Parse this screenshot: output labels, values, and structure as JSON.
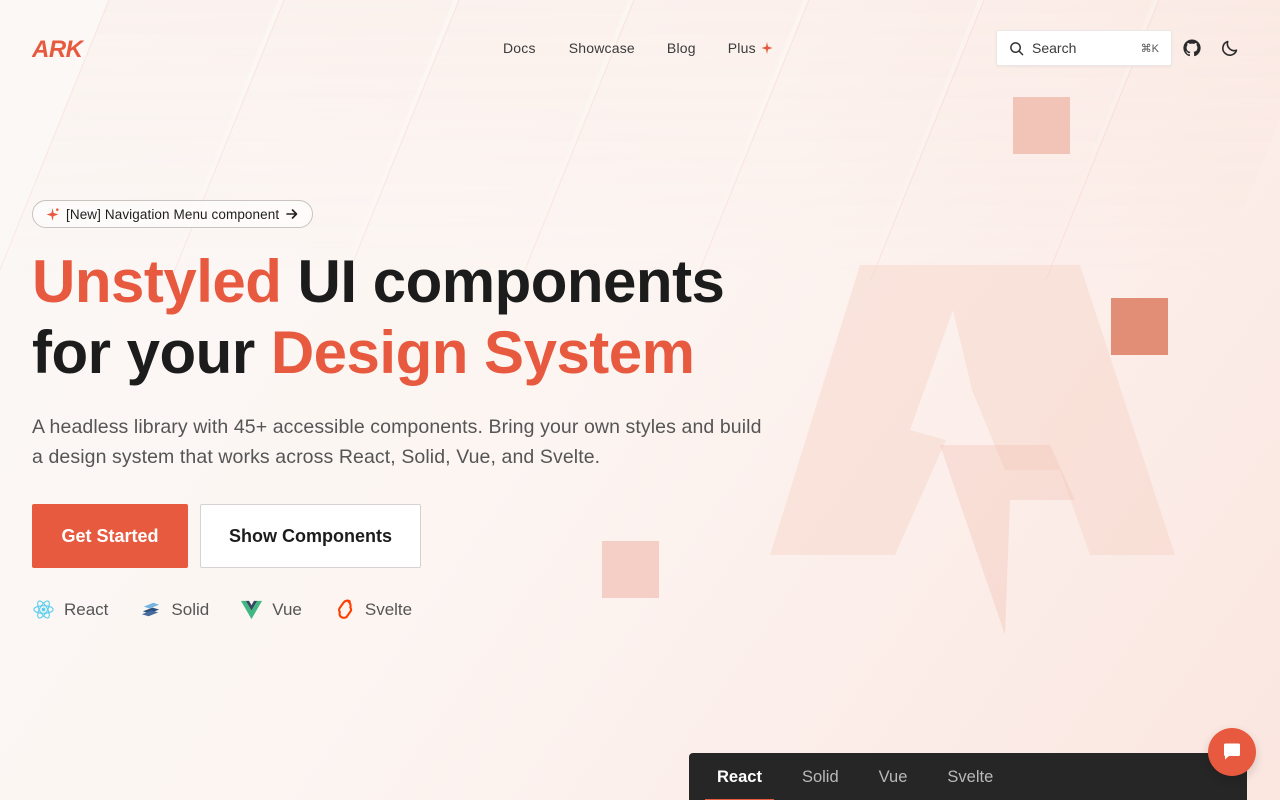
{
  "brand": {
    "name": "ARK",
    "accent": "#e85a3f"
  },
  "nav": {
    "items": [
      {
        "label": "Docs"
      },
      {
        "label": "Showcase"
      },
      {
        "label": "Blog"
      },
      {
        "label": "Plus"
      }
    ]
  },
  "search": {
    "label": "Search",
    "shortcut": "⌘K"
  },
  "announcement": {
    "text": "[New] Navigation Menu component"
  },
  "hero": {
    "title_line1_accent": "Unstyled",
    "title_line1_rest": " UI components",
    "title_line2_rest": "for your ",
    "title_line2_accent": "Design System",
    "lead": "A headless library with 45+ accessible components. Bring your own styles and build a design system that works across React, Solid, Vue, and Svelte."
  },
  "actions": {
    "primary": "Get Started",
    "secondary": "Show Components"
  },
  "frameworks": [
    {
      "label": "React",
      "icon": "react-icon"
    },
    {
      "label": "Solid",
      "icon": "solid-icon"
    },
    {
      "label": "Vue",
      "icon": "vue-icon"
    },
    {
      "label": "Svelte",
      "icon": "svelte-icon"
    }
  ],
  "code_tabs": {
    "active": "React",
    "items": [
      {
        "label": "React"
      },
      {
        "label": "Solid"
      },
      {
        "label": "Vue"
      },
      {
        "label": "Svelte"
      }
    ]
  }
}
